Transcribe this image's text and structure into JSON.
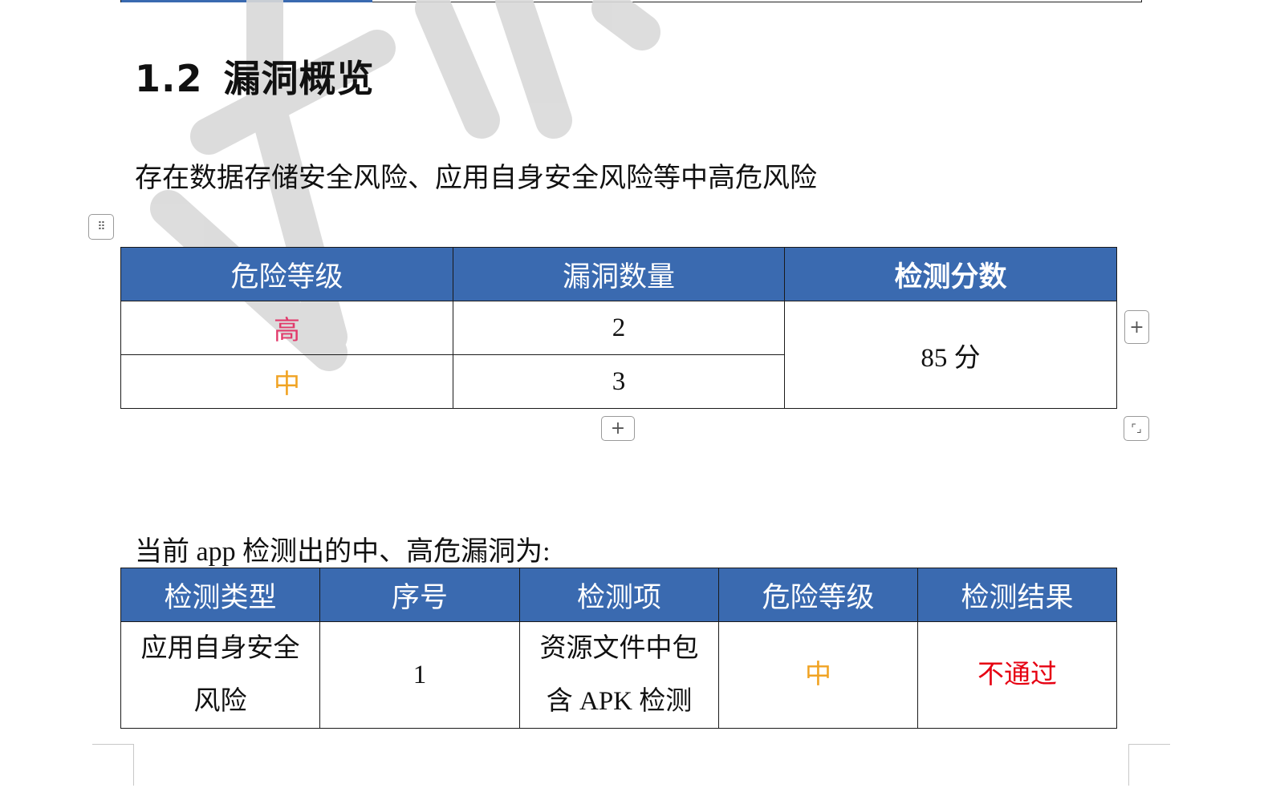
{
  "section": {
    "number": "1.2",
    "title": "漏洞概览"
  },
  "summary_text": "存在数据存储安全风险、应用自身安全风险等中高危风险",
  "overview_table": {
    "headers": [
      "危险等级",
      "漏洞数量",
      "检测分数"
    ],
    "rows": [
      {
        "level": "高",
        "count": "2"
      },
      {
        "level": "中",
        "count": "3"
      }
    ],
    "score": "85 分"
  },
  "detail_intro": "当前 app 检测出的中、高危漏洞为:",
  "detail_table": {
    "headers": [
      "检测类型",
      "序号",
      "检测项",
      "危险等级",
      "检测结果"
    ],
    "rows": [
      {
        "type": "应用自身安全风险",
        "index": "1",
        "item": "资源文件中包含 APK 检测",
        "level": "中",
        "result": "不通过"
      }
    ]
  },
  "handles": {
    "move_icon": "grip-icon",
    "add_icon": "plus-icon",
    "resize_icon": "resize-icon"
  },
  "colors": {
    "header_bg": "#3a6ab0",
    "high": "#e23a6b",
    "medium": "#f0a323",
    "fail": "#e60012"
  }
}
